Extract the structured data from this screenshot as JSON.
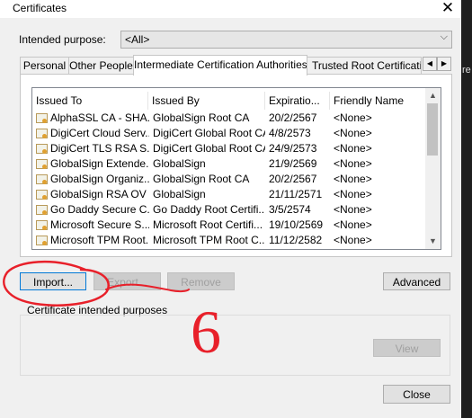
{
  "window": {
    "title": "Certificates",
    "close_glyph": "✕"
  },
  "purpose": {
    "label": "Intended purpose:",
    "value": "<All>",
    "arrow": "⌵"
  },
  "tabs": [
    {
      "label": "Personal"
    },
    {
      "label": "Other People"
    },
    {
      "label": "Intermediate Certification Authorities"
    },
    {
      "label": "Trusted Root Certification"
    }
  ],
  "tab_scroll": {
    "left": "◀",
    "right": "▶"
  },
  "table": {
    "columns": [
      "Issued To",
      "Issued By",
      "Expiratio...",
      "Friendly Name"
    ],
    "rows": [
      [
        "AlphaSSL CA - SHA...",
        "GlobalSign Root CA",
        "20/2/2567",
        "<None>"
      ],
      [
        "DigiCert Cloud Serv...",
        "DigiCert Global Root CA",
        "4/8/2573",
        "<None>"
      ],
      [
        "DigiCert TLS RSA S...",
        "DigiCert Global Root CA",
        "24/9/2573",
        "<None>"
      ],
      [
        "GlobalSign Extende...",
        "GlobalSign",
        "21/9/2569",
        "<None>"
      ],
      [
        "GlobalSign Organiz...",
        "GlobalSign Root CA",
        "20/2/2567",
        "<None>"
      ],
      [
        "GlobalSign RSA OV ...",
        "GlobalSign",
        "21/11/2571",
        "<None>"
      ],
      [
        "Go Daddy Secure C...",
        "Go Daddy Root Certifi...",
        "3/5/2574",
        "<None>"
      ],
      [
        "Microsoft Secure S...",
        "Microsoft Root Certifi...",
        "19/10/2569",
        "<None>"
      ],
      [
        "Microsoft TPM Root...",
        "Microsoft TPM Root C...",
        "11/12/2582",
        "<None>"
      ]
    ],
    "scroll_up": "▲",
    "scroll_down": "▼"
  },
  "buttons": {
    "import": "Import...",
    "export": "Export...",
    "remove": "Remove",
    "advanced": "Advanced",
    "view": "View",
    "close": "Close"
  },
  "purposes_group": {
    "label": "Certificate intended purposes"
  },
  "side_glyph": "re",
  "colors": {
    "annotation": "#e8202a",
    "focus": "#0078d7",
    "outside": "#1f1f1f"
  },
  "annotation": {
    "step_number": "6"
  }
}
